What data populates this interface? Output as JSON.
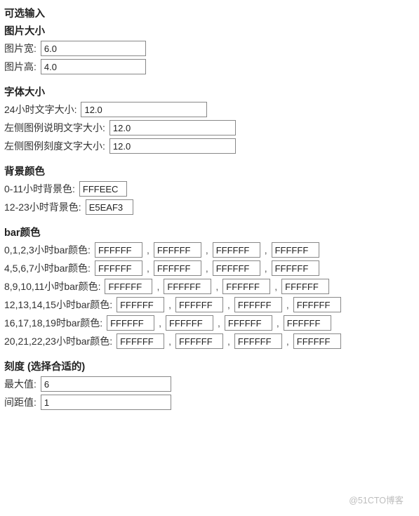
{
  "headings": {
    "optional_input": "可选输入",
    "image_size": "图片大小",
    "font_size": "字体大小",
    "bg_color": "背景颜色",
    "bar_color": "bar颜色",
    "scale": "刻度  (选择合适的)"
  },
  "image_size": {
    "width_label": "图片宽:",
    "width_value": "6.0",
    "height_label": "图片高:",
    "height_value": "4.0"
  },
  "font_size": {
    "hour24_label": "24小时文字大小:",
    "hour24_value": "12.0",
    "legend_desc_label": "左侧图例说明文字大小:",
    "legend_desc_value": "12.0",
    "legend_tick_label": "左侧图例刻度文字大小:",
    "legend_tick_value": "12.0"
  },
  "bg_color": {
    "bg0_label": "0-11小时背景色:",
    "bg0_value": "FFFEEC",
    "bg1_label": "12-23小时背景色:",
    "bg1_value": "E5EAF3"
  },
  "bar_color": {
    "sep": ",",
    "rows": [
      {
        "label": "0,1,2,3小时bar颜色:",
        "v": [
          "FFFFFF",
          "FFFFFF",
          "FFFFFF",
          "FFFFFF"
        ]
      },
      {
        "label": "4,5,6,7小时bar颜色:",
        "v": [
          "FFFFFF",
          "FFFFFF",
          "FFFFFF",
          "FFFFFF"
        ]
      },
      {
        "label": "8,9,10,11小时bar颜色:",
        "v": [
          "FFFFFF",
          "FFFFFF",
          "FFFFFF",
          "FFFFFF"
        ]
      },
      {
        "label": "12,13,14,15小时bar颜色:",
        "v": [
          "FFFFFF",
          "FFFFFF",
          "FFFFFF",
          "FFFFFF"
        ]
      },
      {
        "label": "16,17,18,19时bar颜色:",
        "v": [
          "FFFFFF",
          "FFFFFF",
          "FFFFFF",
          "FFFFFF"
        ]
      },
      {
        "label": "20,21,22,23小时bar颜色:",
        "v": [
          "FFFFFF",
          "FFFFFF",
          "FFFFFF",
          "FFFFFF"
        ]
      }
    ]
  },
  "scale": {
    "max_label": "最大值:",
    "max_value": "6",
    "gap_label": "间距值:",
    "gap_value": "1"
  },
  "watermark": "@51CTO博客"
}
